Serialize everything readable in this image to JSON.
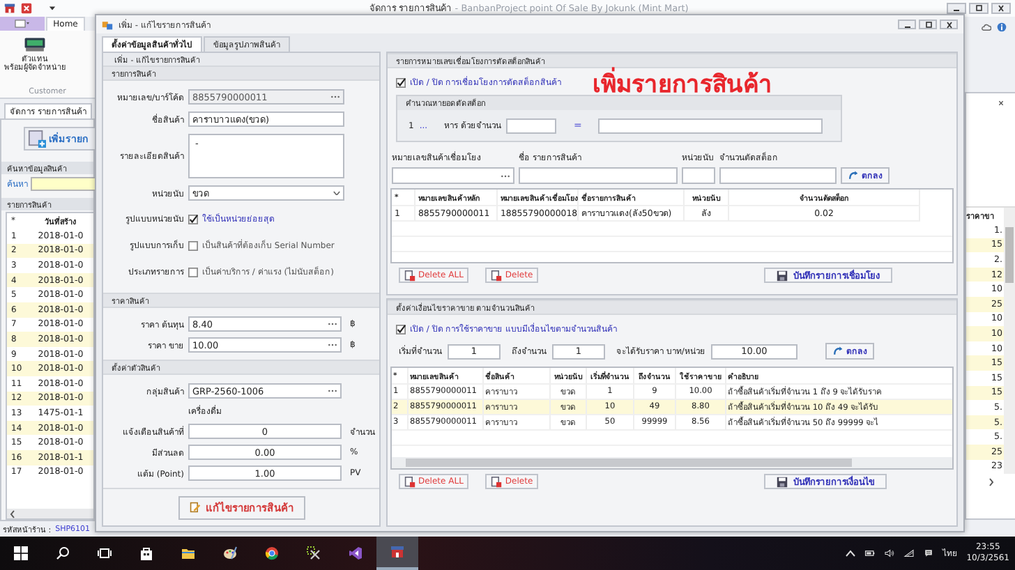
{
  "app": {
    "title": "จัดการ รายการสินค้า",
    "subtitle": " - BanbanProject point Of Sale By Jokunk (Mint Mart)"
  },
  "ribbon": {
    "tabs": [
      {
        "label": "Home",
        "selected": true
      }
    ],
    "buttons": [
      {
        "lines": [
          "ตัวแทน",
          "พร้อมผู้จัดจำหน่าย"
        ]
      }
    ],
    "group": "Customer"
  },
  "left_panel": {
    "tab": "จัดการ รายการสินค้า",
    "add_button": "เพิ่มรายก",
    "search_title": "ค้นหาข้อมูลสินค้า",
    "search_label": "ค้นหา",
    "list_title": "รายการสินค้า",
    "columns": [
      "*",
      "วันที่สร้าง"
    ],
    "rows": [
      [
        "1",
        "2018-01-0"
      ],
      [
        "2",
        "2018-01-0"
      ],
      [
        "3",
        "2018-01-0"
      ],
      [
        "4",
        "2018-01-0"
      ],
      [
        "5",
        "2018-01-0"
      ],
      [
        "6",
        "2018-01-0"
      ],
      [
        "7",
        "2018-01-0"
      ],
      [
        "8",
        "2018-01-0"
      ],
      [
        "9",
        "2018-01-0"
      ],
      [
        "10",
        "2018-01-0"
      ],
      [
        "11",
        "2018-01-0"
      ],
      [
        "12",
        "2018-01-0"
      ],
      [
        "13",
        "1475-01-1"
      ],
      [
        "14",
        "2018-01-0"
      ],
      [
        "15",
        "2018-01-0"
      ],
      [
        "16",
        "2018-01-1"
      ],
      [
        "17",
        "2018-01-0"
      ]
    ]
  },
  "right_strip": {
    "column": "ราคาขา",
    "values": [
      "1.",
      "15",
      "2.",
      "12",
      "10",
      "25",
      "10",
      "10",
      "10",
      "15",
      "15",
      "15",
      "5.",
      "5.",
      "5.",
      "25",
      "23"
    ]
  },
  "status_bar": {
    "label": "รหัสหน้าร้าน :",
    "value": "SHP6101"
  },
  "dialog": {
    "title": "เพิ่ม - แก้ไขรายการสินค้า",
    "tabs": [
      {
        "label": "ตั้งค่าข้อมูลสินค้าทั่วไป",
        "selected": true
      },
      {
        "label": "ข้อมูลรูปภาพสินค้า",
        "selected": false
      }
    ],
    "product": {
      "header": "เพิ่ม - แก้ไขรายการสินค้า",
      "section": "รายการสินค้า",
      "fields": [
        {
          "kind": "browse",
          "label": "หมายเลข/บาร์โค้ด",
          "value": "8855790000011",
          "disabled": true
        },
        {
          "kind": "text",
          "label": "ชื่อสินค้า",
          "value": "คาราบาวแดง(ขวด)",
          "disabled": false
        },
        {
          "kind": "textarea",
          "label": "รายละเอียดสินค้า",
          "value": "-",
          "disabled": false
        },
        {
          "kind": "select",
          "label": "หน่วยนับ",
          "value": "ขวด",
          "disabled": false
        }
      ],
      "options": [
        {
          "label": "รูปแบบหน่วยนับ",
          "text": "ใช้เป็นหน่วยย่อยสุด",
          "checked": true
        },
        {
          "label": "รูปแบบการเก็บ",
          "text": "เป็นสินค้าที่ต้องเก็บ Serial Number",
          "checked": false
        },
        {
          "label": "ประเภทรายการ",
          "text": "เป็นค่าบริการ / ค่าแรง (ไม่นับสต็อก)",
          "checked": false
        }
      ]
    },
    "price": {
      "section": "ราคาสินค้า",
      "fields": [
        {
          "label": "ราคา ต้นทุน",
          "value": "8.40",
          "unit": "฿"
        },
        {
          "label": "ราคา ขาย",
          "value": "10.00",
          "unit": "฿"
        }
      ]
    },
    "settings": {
      "section": "ตั้งค่าตัวสินค้า",
      "group": {
        "label": "กลุ่มสินค้า",
        "value": "GRP-2560-1006",
        "name": "เครื่องดื่ม"
      },
      "fields": [
        {
          "label": "แจ้งเตือนสินค้าที่",
          "value": "0",
          "unit": "จำนวน"
        },
        {
          "label": "มีส่วนลด",
          "value": "0.00",
          "unit": "%"
        },
        {
          "label": "แต้ม (Point)",
          "value": "1.00",
          "unit": "PV"
        }
      ]
    },
    "save_button": "แก้ไขรายการสินค้า",
    "stock_link": {
      "section": "รายการหมายเลขเชื่อมโยงการตัดสต็อกสินค้า",
      "toggle": {
        "text": "เปิด / ปิด การเชื่อมโยงการตัดสต็อกสินค้า",
        "checked": true
      },
      "banner": "เพิ่มรายการสินค้า",
      "calc": {
        "title": "คำนวณหายอดตัดสต็อก",
        "number": "1",
        "more": "...",
        "divide_label": "หาร ด้วยจำนวน",
        "equals": "="
      },
      "inputs": [
        {
          "kind": "browse",
          "label": "หมายเลขสินค้าเชื่อมโยง"
        },
        {
          "kind": "text",
          "label": "ชื่อ รายการสินค้า"
        },
        {
          "kind": "text",
          "label": "หน่วยนับ"
        },
        {
          "kind": "text",
          "label": "จำนวนตัดสต็อก"
        }
      ],
      "ok_button": "ตกลง",
      "columns": [
        "*",
        "หมายเลขสินค้าหลัก",
        "หมายเลขสินค้าเชื่อมโยง",
        "ชื่อรายการสินค้า",
        "หน่วยนับ",
        "จำนวนตัดสต็อก"
      ],
      "rows": [
        [
          "1",
          "8855790000011",
          "18855790000018",
          "คาราบาวแดง(ลัง50ขวด)",
          "ลัง",
          "0.02"
        ]
      ],
      "delete_all": "Delete ALL",
      "delete": "Delete",
      "save": "บันทึกรายการเชื่อมโยง"
    },
    "price_rules": {
      "section": "ตั้งค่าเงื่อนไขราคาขาย ตามจำนวนสินค้า",
      "toggle": {
        "text": "เปิด / ปิด การใช้ราคาขาย แบบมีเงื่อนไขตามจำนวนสินค้า",
        "checked": true
      },
      "inputs": [
        {
          "label": "เริ่มที่จำนวน",
          "value": "1"
        },
        {
          "label": "ถึงจำนวน",
          "value": "1"
        },
        {
          "label": "จะได้รับราคา บาท/หน่วย",
          "value": "10.00"
        }
      ],
      "ok_button": "ตกลง",
      "columns": [
        "*",
        "หมายเลขสินค้า",
        "ชื่อสินค้า",
        "หน่วยนับ",
        "เริ่มที่จำนวน",
        "ถึงจำนวน",
        "ใช้ราคาขาย",
        "คำอธิบาย"
      ],
      "rows": [
        {
          "selected": false,
          "cells": [
            "1",
            "8855790000011",
            "คาราบาว",
            "ขวด",
            "1",
            "9",
            "10.00",
            "ถ้าซื้อสินค้าเริ่มที่จำนวน 1 ถึง 9 จะได้รับราค"
          ]
        },
        {
          "selected": true,
          "cells": [
            "2",
            "8855790000011",
            "คาราบาว",
            "ขวด",
            "10",
            "49",
            "8.80",
            "ถ้าซื้อสินค้าเริ่มที่จำนวน 10 ถึง 49 จะได้รับ"
          ]
        },
        {
          "selected": false,
          "cells": [
            "3",
            "8855790000011",
            "คาราบาว",
            "ขวด",
            "50",
            "99999",
            "8.56",
            "ถ้าซื้อสินค้าเริ่มที่จำนวน 50 ถึง 99999 จะไ"
          ]
        }
      ],
      "delete_all": "Delete ALL",
      "delete": "Delete",
      "save": "บันทึกรายการเงื่อนไข"
    }
  },
  "taskbar": {
    "apps": [
      {
        "kind": "search",
        "selected": false
      },
      {
        "kind": "taskview",
        "selected": false
      },
      {
        "kind": "store",
        "selected": false
      },
      {
        "kind": "folder",
        "selected": false
      },
      {
        "kind": "paint",
        "selected": false
      },
      {
        "kind": "browser",
        "selected": false
      },
      {
        "kind": "tools",
        "selected": false
      },
      {
        "kind": "studio",
        "selected": false
      },
      {
        "kind": "shop",
        "selected": true
      }
    ],
    "language": "ไทย",
    "time": "23:55",
    "date": "10/3/2561"
  }
}
